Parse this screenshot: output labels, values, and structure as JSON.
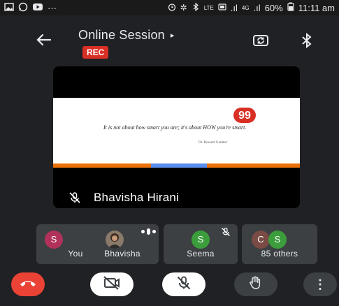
{
  "status_bar": {
    "battery": "60%",
    "time": "11:11 am",
    "network_tag": "4G",
    "volte": "LTE",
    "signal": ".ıl",
    "more": "···"
  },
  "header": {
    "title": "Online Session",
    "title_arrow": "▸",
    "rec_label": "REC"
  },
  "main_tile": {
    "participant_name": "Bhavisha Hirani",
    "slide_quote": "It is not about how smart you are; it's about HOW you're smart.",
    "slide_author": "Dr. Howard Gardner",
    "slide_quote_mark": "99"
  },
  "participants": [
    {
      "label": "You",
      "initial": "S",
      "avatar_color": "#b0325a",
      "muted": true
    },
    {
      "label": "Bhavisha",
      "initial": "",
      "avatar_color": "#8a7a6a",
      "speaking": true
    },
    {
      "label": "Seema",
      "initial": "S",
      "avatar_color": "#3c9d3c",
      "muted": true
    },
    {
      "label": "85 others",
      "initial_1": "C",
      "initial_2": "S",
      "avatar_color_1": "#7a4b44",
      "avatar_color_2": "#3c9d3c"
    }
  ],
  "controls": {
    "end_call": "end-call",
    "camera": "camera-off",
    "mic": "mic-off",
    "raise_hand": "raise-hand",
    "more": "⋮"
  },
  "colors": {
    "background": "#202124",
    "rec": "#d93025",
    "end_call": "#ea4335",
    "tile": "#3c4043"
  }
}
